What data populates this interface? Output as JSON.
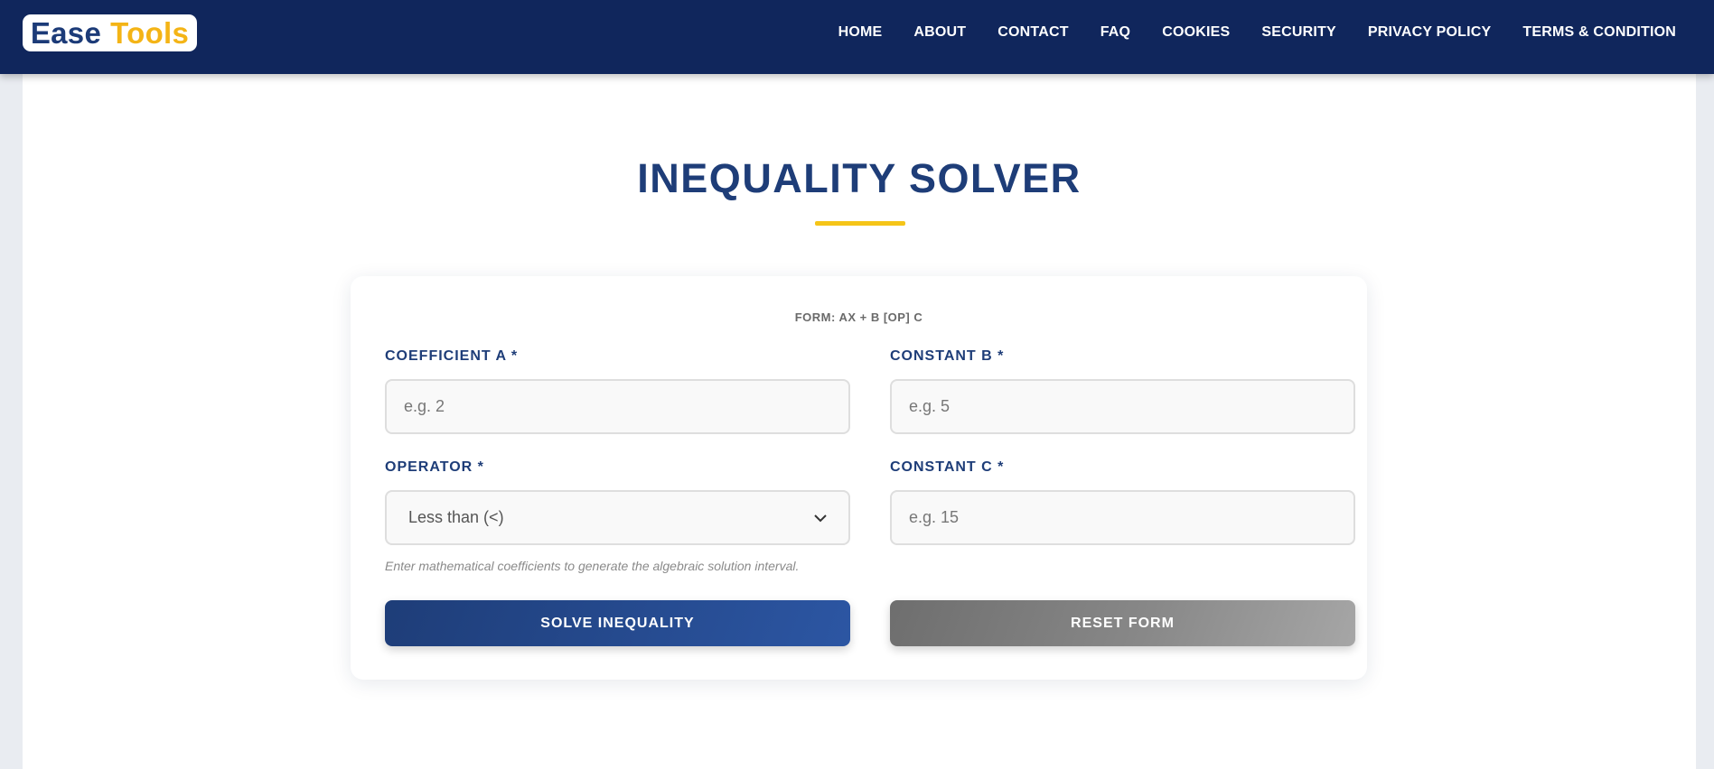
{
  "header": {
    "logo": {
      "word1": "Ease",
      "word2": "Tools"
    },
    "nav": [
      "HOME",
      "ABOUT",
      "CONTACT",
      "FAQ",
      "COOKIES",
      "SECURITY",
      "PRIVACY POLICY",
      "TERMS & CONDITION"
    ]
  },
  "main": {
    "title": "INEQUALITY SOLVER",
    "form_caption": "FORM: AX + B [OP] C",
    "fields": {
      "coefficient_a": {
        "label": "COEFFICIENT A *",
        "placeholder": "e.g. 2"
      },
      "constant_b": {
        "label": "CONSTANT B *",
        "placeholder": "e.g. 5"
      },
      "operator": {
        "label": "OPERATOR *",
        "selected": "Less than (<)"
      },
      "constant_c": {
        "label": "CONSTANT C *",
        "placeholder": "e.g. 15"
      }
    },
    "hint": "Enter mathematical coefficients to generate the algebraic solution interval.",
    "buttons": {
      "solve": "SOLVE INEQUALITY",
      "reset": "RESET FORM"
    }
  },
  "colors": {
    "header_bg": "#10265c",
    "primary": "#1e3d78",
    "accent": "#f5c518",
    "logo_accent": "#f4b416"
  },
  "icons": {
    "select_chevron": "chevron-down-icon"
  }
}
